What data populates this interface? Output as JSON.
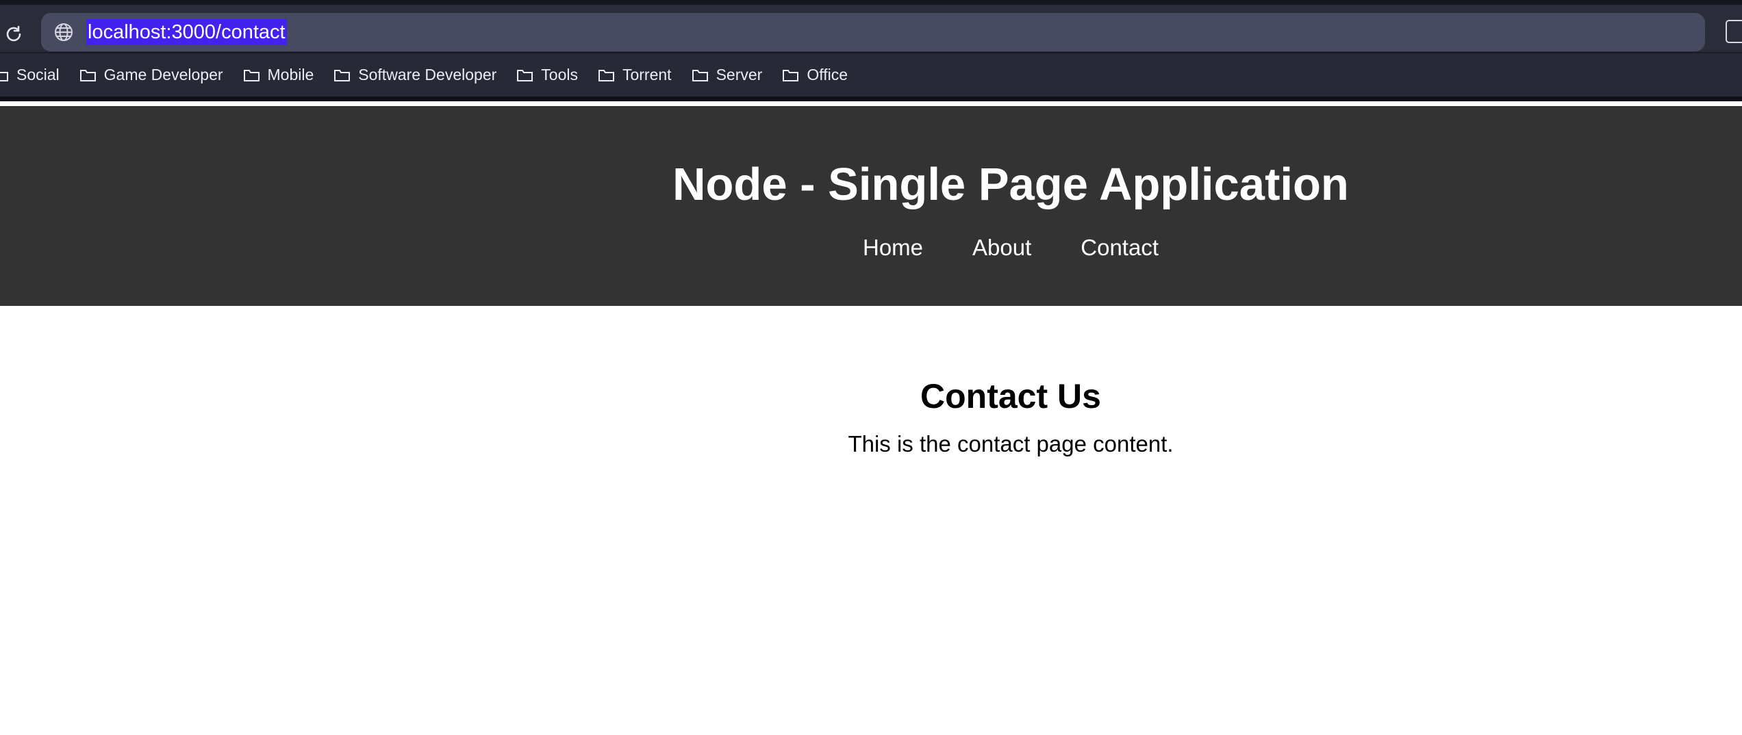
{
  "browser": {
    "url": "localhost:3000/contact",
    "icons": {
      "reload": "reload-icon",
      "site_info": "globe-icon",
      "screenshot": "screenshot-icon"
    },
    "bookmarks": [
      {
        "label": "Social",
        "icon": "folder-icon"
      },
      {
        "label": "Game Developer",
        "icon": "folder-icon"
      },
      {
        "label": "Mobile",
        "icon": "folder-icon"
      },
      {
        "label": "Software Developer",
        "icon": "folder-icon"
      },
      {
        "label": "Tools",
        "icon": "folder-icon"
      },
      {
        "label": "Torrent",
        "icon": "folder-icon"
      },
      {
        "label": "Server",
        "icon": "folder-icon"
      },
      {
        "label": "Office",
        "icon": "folder-icon"
      }
    ]
  },
  "page": {
    "site_title": "Node - Single Page Application",
    "nav": [
      {
        "label": "Home"
      },
      {
        "label": "About"
      },
      {
        "label": "Contact"
      }
    ],
    "heading": "Contact Us",
    "body_text": "This is the contact page content."
  },
  "colors": {
    "header_bg": "#333333",
    "selection_highlight": "#4422ee",
    "chrome_bg": "#2a2c39",
    "address_bar_bg": "#474b60"
  }
}
